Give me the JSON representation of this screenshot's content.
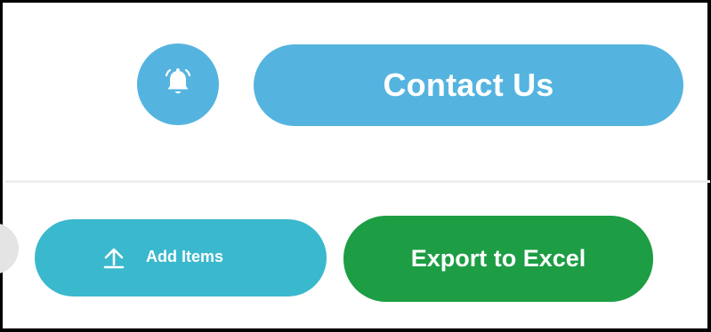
{
  "header": {
    "notifications_icon": "bell-icon",
    "contact_label": "Contact Us"
  },
  "actions": {
    "add_items_icon": "upload-arrow-icon",
    "add_items_label": "Add Items",
    "export_label": "Export to Excel"
  },
  "colors": {
    "header_button": "#55b4df",
    "add_items_button": "#3ab8cd",
    "export_button": "#1d9d44",
    "text_on_button": "#ffffff",
    "divider": "#eeeeee"
  }
}
